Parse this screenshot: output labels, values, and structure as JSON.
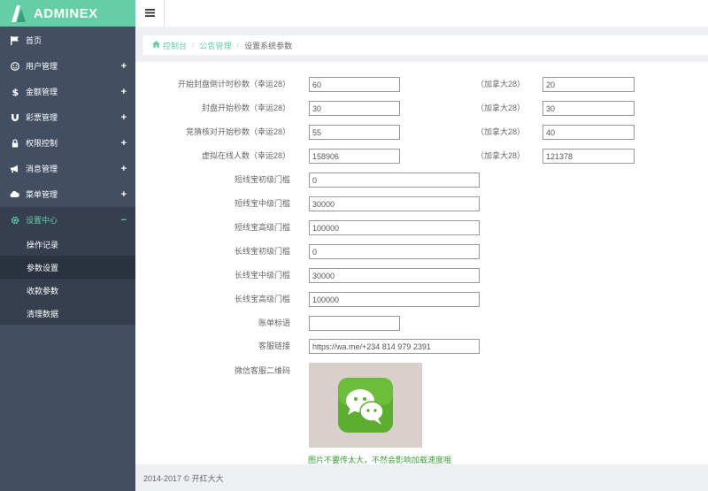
{
  "app": {
    "name": "ADMINEX",
    "accent": "#65cea7",
    "sidebar_bg": "#424f63"
  },
  "sidebar": {
    "items": [
      {
        "label": "首页",
        "icon": "flag-icon",
        "expand": ""
      },
      {
        "label": "用户管理",
        "icon": "user-circle-icon",
        "expand": "+"
      },
      {
        "label": "金额管理",
        "icon": "dollar-icon",
        "expand": "+"
      },
      {
        "label": "彩票管理",
        "icon": "magnet-icon",
        "expand": "+"
      },
      {
        "label": "权限控制",
        "icon": "lock-icon",
        "expand": "+"
      },
      {
        "label": "消息管理",
        "icon": "bullhorn-icon",
        "expand": "+"
      },
      {
        "label": "菜单管理",
        "icon": "cloud-icon",
        "expand": "+"
      },
      {
        "label": "设置中心",
        "icon": "gear-icon",
        "expand": "−"
      }
    ],
    "subitems": [
      {
        "label": "操作记录"
      },
      {
        "label": "参数设置"
      },
      {
        "label": "收款参数"
      },
      {
        "label": "清理数据"
      }
    ]
  },
  "header": {
    "toggle_icon": "menu-icon"
  },
  "breadcrumb": {
    "home": "控制台",
    "parent": "公告管理",
    "current": "设置系统参数",
    "sep": "/"
  },
  "form": {
    "rows": [
      {
        "label": "开始封盘倒计时秒数（幸运28）",
        "value": "60",
        "compare_label": "（加拿大28）",
        "compare_value": "20"
      },
      {
        "label": "封盘开始秒数（幸运28）",
        "value": "30",
        "compare_label": "（加拿大28）",
        "compare_value": "30"
      },
      {
        "label": "竞猜核对开始秒数（幸运28）",
        "value": "55",
        "compare_label": "（加拿大28）",
        "compare_value": "40"
      },
      {
        "label": "虚拟在线人数（幸运28）",
        "value": "158906",
        "compare_label": "（加拿大28）",
        "compare_value": "121378"
      }
    ],
    "thresholds": [
      {
        "label": "短线宝初级门槛",
        "value": "0"
      },
      {
        "label": "短线宝中级门槛",
        "value": "30000"
      },
      {
        "label": "短线宝高级门槛",
        "value": "100000"
      },
      {
        "label": "长线宝初级门槛",
        "value": "0"
      },
      {
        "label": "长线宝中级门槛",
        "value": "30000"
      },
      {
        "label": "长线宝高级门槛",
        "value": "100000"
      }
    ],
    "bill_label": "账单标语",
    "bill_value": "",
    "service_label": "客服链接",
    "service_value": "https://wa.me/+234 814 979 2391",
    "qr_label": "微信客服二维码",
    "qr_icon": "wechat-icon",
    "hint": "图片不要传太大，不然会影响加载速度哦"
  },
  "footer": {
    "text": "2014-2017 © 开红大大"
  }
}
